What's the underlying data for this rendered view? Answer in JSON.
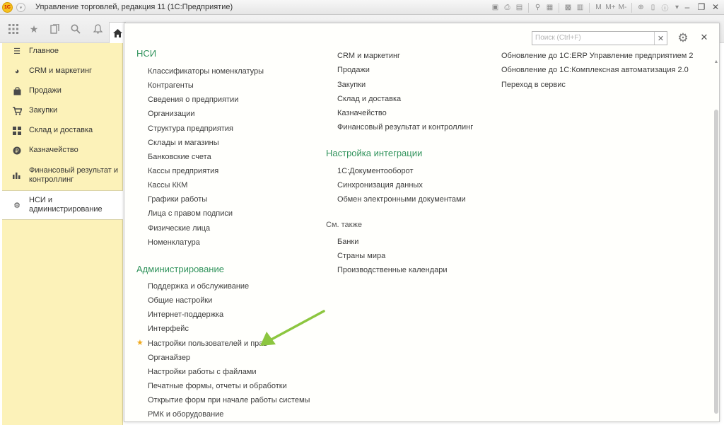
{
  "titlebar": {
    "logo_text": "1С",
    "title": "Управление торговлей, редакция 11  (1С:Предприятие)",
    "tools": [
      "M",
      "M+",
      "M-"
    ]
  },
  "toolbar": {
    "icons": [
      "apps-grid-icon",
      "star-icon",
      "history-icon",
      "search-icon",
      "bell-icon",
      "home-icon"
    ]
  },
  "sidebar": {
    "items": [
      {
        "label": "Главное",
        "icon": "menu-icon"
      },
      {
        "label": "CRM и маркетинг",
        "icon": "pie-icon"
      },
      {
        "label": "Продажи",
        "icon": "bag-icon"
      },
      {
        "label": "Закупки",
        "icon": "cart-icon"
      },
      {
        "label": "Склад и доставка",
        "icon": "grid-icon"
      },
      {
        "label": "Казначейство",
        "icon": "coin-icon"
      },
      {
        "label": "Финансовый результат и контроллинг",
        "icon": "bar-chart-icon"
      },
      {
        "label": "НСИ и администрирование",
        "icon": "gear-icon",
        "active": true
      }
    ]
  },
  "search": {
    "placeholder": "Поиск (Ctrl+F)"
  },
  "columns": {
    "col1": {
      "nsi_title": "НСИ",
      "nsi_links": [
        "Классификаторы номенклатуры",
        "Контрагенты",
        "Сведения о предприятии",
        "Организации",
        "Структура предприятия",
        "Склады и магазины",
        "Банковские счета",
        "Кассы предприятия",
        "Кассы ККМ",
        "Графики работы",
        "Лица с правом подписи",
        "Физические лица",
        "Номенклатура"
      ],
      "admin_title": "Администрирование",
      "admin_links": [
        "Поддержка и обслуживание",
        "Общие настройки",
        "Интернет-поддержка",
        "Интерфейс",
        "Настройки пользователей и прав",
        "Органайзер",
        "Настройки работы с файлами",
        "Печатные формы, отчеты и обработки",
        "Открытие форм при начале работы системы",
        "РМК и оборудование"
      ]
    },
    "col2": {
      "top_links": [
        "CRM и маркетинг",
        "Продажи",
        "Закупки",
        "Склад и доставка",
        "Казначейство",
        "Финансовый результат и контроллинг"
      ],
      "integration_title": "Настройка интеграции",
      "integration_links": [
        "1С:Документооборот",
        "Синхронизация данных",
        "Обмен электронными документами"
      ],
      "see_also_label": "См. также",
      "see_also_links": [
        "Банки",
        "Страны мира",
        "Производственные календари"
      ]
    },
    "col3": {
      "links": [
        "Обновление до 1С:ERP Управление предприятием 2",
        "Обновление до 1С:Комплексная автоматизация 2.0",
        "Переход в сервис"
      ]
    }
  },
  "colors": {
    "section_heading": "#31935c",
    "sidebar_bg": "#fcf2b9",
    "arrow": "#8cc63f",
    "favorite_star": "#f0a81a"
  }
}
